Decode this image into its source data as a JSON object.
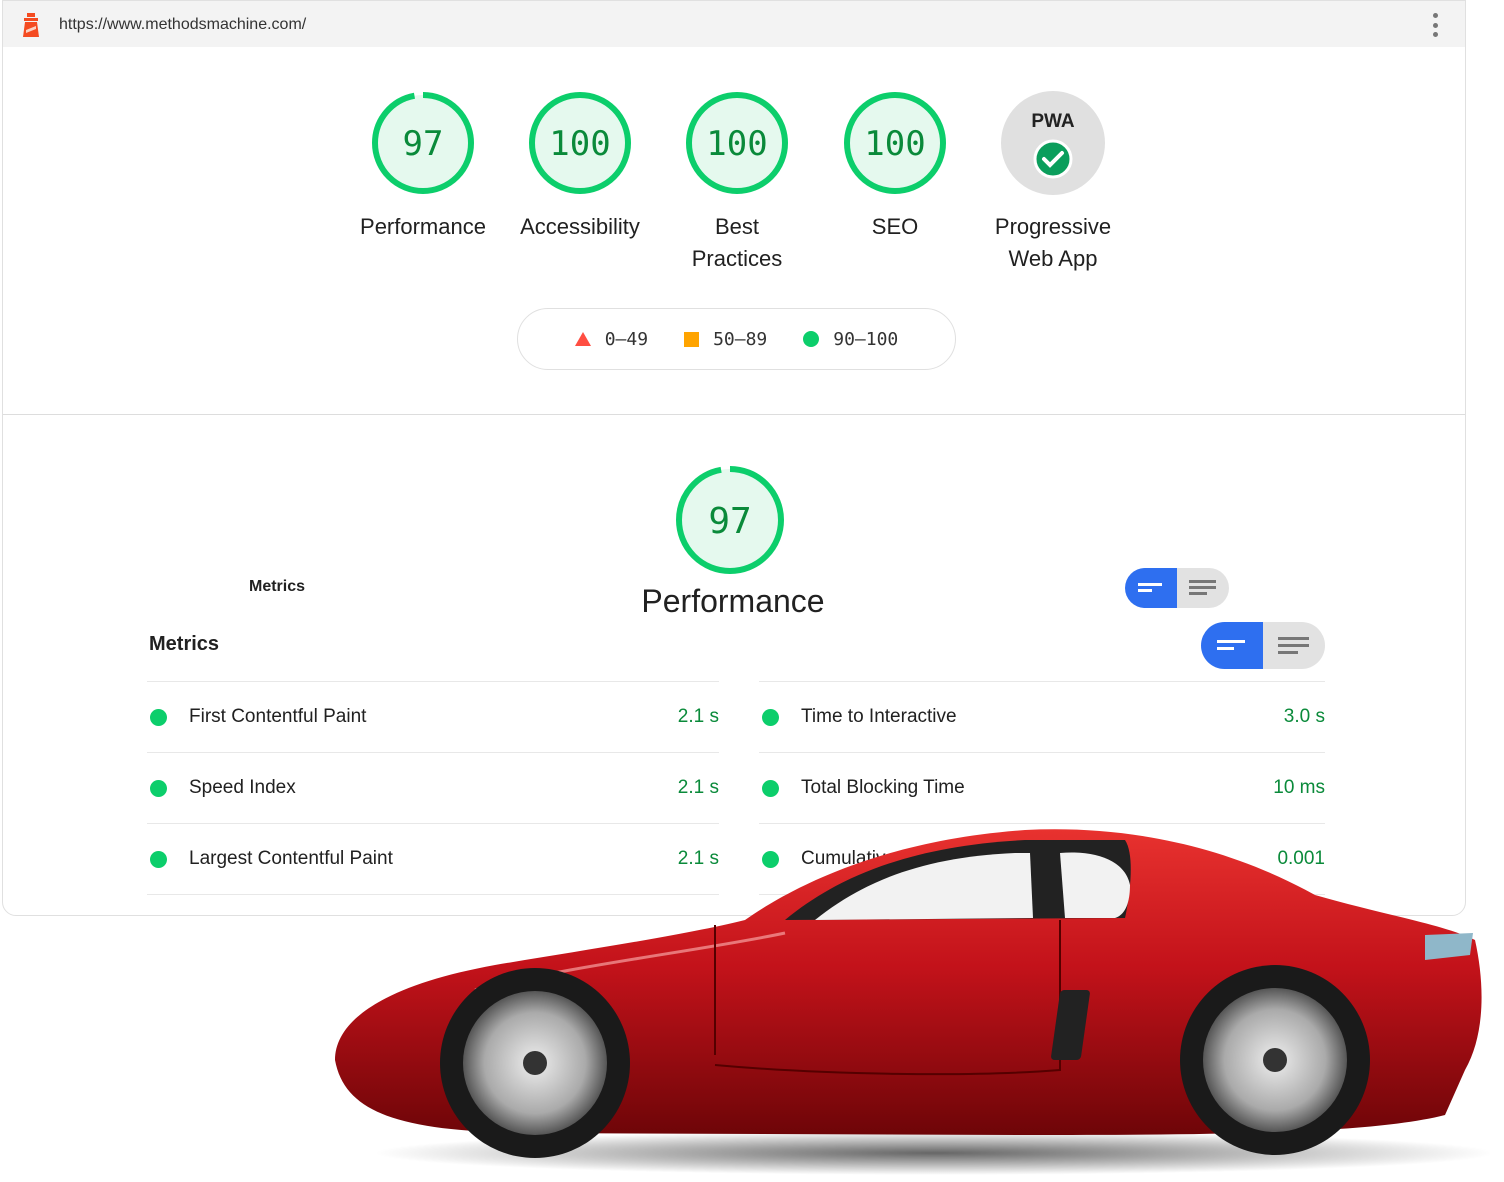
{
  "browser": {
    "url": "https://www.methodsmachine.com/",
    "logo_icon": "lighthouse-icon",
    "menu_icon": "kebab-menu-icon"
  },
  "categories": [
    {
      "score": "97",
      "label": "Performance"
    },
    {
      "score": "100",
      "label": "Accessibility"
    },
    {
      "score": "100",
      "label": "Best Practices"
    },
    {
      "score": "100",
      "label": "SEO"
    },
    {
      "badge": "PWA",
      "label": "Progressive Web App",
      "icon": "check-circle-icon"
    }
  ],
  "legend": [
    {
      "range": "0–49",
      "shape": "triangle",
      "color": "#ff4e42"
    },
    {
      "range": "50–89",
      "shape": "square",
      "color": "#ffa400"
    },
    {
      "range": "90–100",
      "shape": "circle",
      "color": "#0cce6b"
    }
  ],
  "performance": {
    "score": "97",
    "title": "Performance",
    "metrics_label_small": "Metrics",
    "metrics_heading": "Metrics"
  },
  "metrics": {
    "left": [
      {
        "name": "First Contentful Paint",
        "value": "2.1 s"
      },
      {
        "name": "Speed Index",
        "value": "2.1 s"
      },
      {
        "name": "Largest Contentful Paint",
        "value": "2.1 s"
      }
    ],
    "right": [
      {
        "name": "Time to Interactive",
        "value": "3.0 s"
      },
      {
        "name": "Total Blocking Time",
        "value": "10 ms"
      },
      {
        "name": "Cumulative Layout Shift",
        "value": "0.001"
      }
    ]
  },
  "colors": {
    "pass": "#0cce6b",
    "pass_text": "#008800",
    "accent": "#2e6ff0",
    "car": "#c8141a"
  }
}
